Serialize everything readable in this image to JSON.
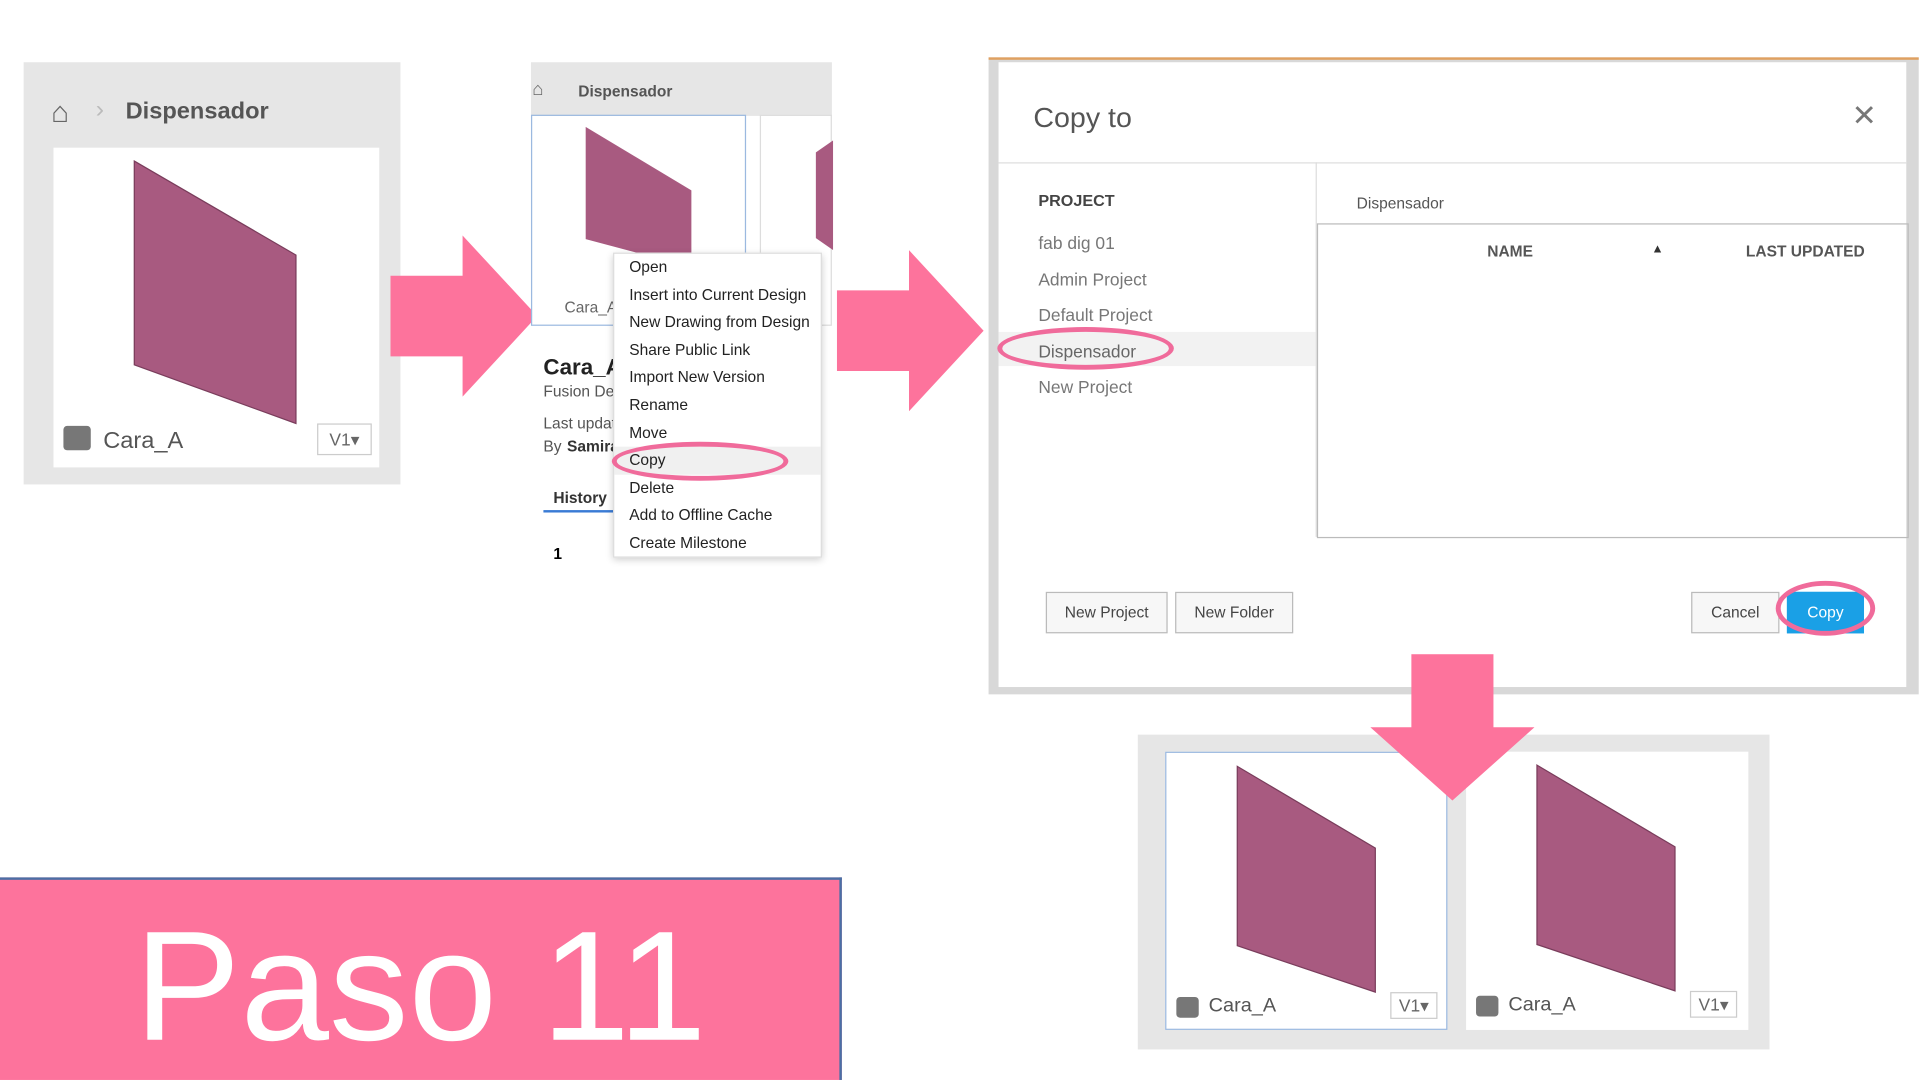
{
  "step1": {
    "breadcrumb": "Dispensador",
    "file_name": "Cara_A",
    "version": "V1"
  },
  "step2": {
    "breadcrumb": "Dispensador",
    "thumb_label": "Cara_A",
    "title": "Cara_A",
    "type": "Fusion Design",
    "last_updated": "Last updated",
    "by": "By",
    "author": "Samira",
    "history_tab": "History",
    "history_row": "1",
    "menu": [
      "Open",
      "Insert into Current Design",
      "New Drawing from Design",
      "Share Public Link",
      "Import New Version",
      "Rename",
      "Move",
      "Copy",
      "Delete",
      "Add to Offline Cache",
      "Create Milestone"
    ]
  },
  "dialog": {
    "title": "Copy to",
    "project_header": "PROJECT",
    "projects": [
      "fab dig 01",
      "Admin Project",
      "Default Project",
      "Dispensador",
      "New Project"
    ],
    "selected_project": "Dispensador",
    "folder_path": "Dispensador",
    "col_name": "NAME",
    "col_updated": "LAST UPDATED",
    "new_project": "New Project",
    "new_folder": "New Folder",
    "cancel": "Cancel",
    "copy": "Copy"
  },
  "result": {
    "items": [
      {
        "name": "Cara_A",
        "version": "V1"
      },
      {
        "name": "Cara_A",
        "version": "V1"
      }
    ]
  },
  "step_label": "Paso 11",
  "colors": {
    "accent": "#fd739c",
    "plate": "#a85a80",
    "copy_button": "#1aa0e6"
  }
}
